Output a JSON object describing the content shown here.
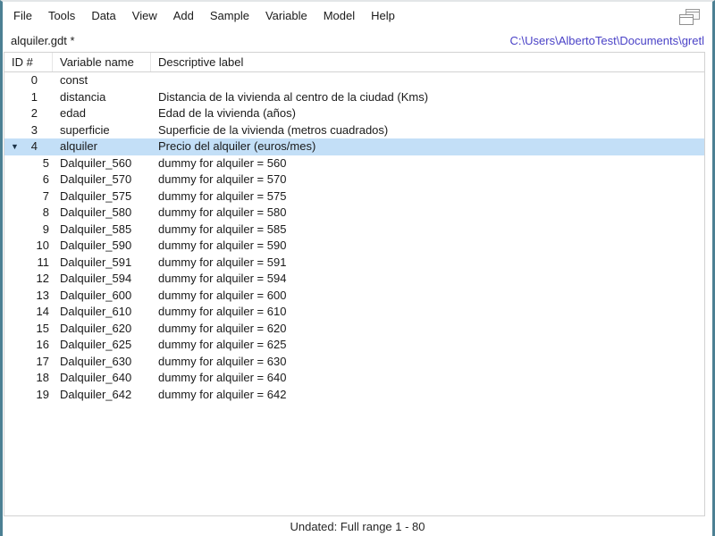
{
  "window": {
    "edge_color": "#4c8093"
  },
  "menu": {
    "items": [
      "File",
      "Tools",
      "Data",
      "View",
      "Add",
      "Sample",
      "Variable",
      "Model",
      "Help"
    ]
  },
  "titlebar": {
    "filename": "alquiler.gdt *",
    "workdir": "C:\\Users\\AlbertoTest\\Documents\\gretl",
    "workdir_style": "color:#4a42c7"
  },
  "table": {
    "columns": [
      "ID #",
      "Variable name",
      "Descriptive label"
    ],
    "expander_glyph": "▼",
    "selected_bg": "#c3dff7",
    "rows": [
      {
        "id": "0",
        "name": "const",
        "label": "",
        "child": false,
        "selected": false,
        "expander": false
      },
      {
        "id": "1",
        "name": "distancia",
        "label": "Distancia de la vivienda al centro de la ciudad (Kms)",
        "child": false,
        "selected": false,
        "expander": false
      },
      {
        "id": "2",
        "name": "edad",
        "label": "Edad de la vivienda (años)",
        "child": false,
        "selected": false,
        "expander": false
      },
      {
        "id": "3",
        "name": "superficie",
        "label": "Superficie de la vivienda (metros cuadrados)",
        "child": false,
        "selected": false,
        "expander": false
      },
      {
        "id": "4",
        "name": "alquiler",
        "label": "Precio del alquiler (euros/mes)",
        "child": false,
        "selected": true,
        "expander": true
      },
      {
        "id": "5",
        "name": "Dalquiler_560",
        "label": "dummy for alquiler = 560",
        "child": true,
        "selected": false,
        "expander": false
      },
      {
        "id": "6",
        "name": "Dalquiler_570",
        "label": "dummy for alquiler = 570",
        "child": true,
        "selected": false,
        "expander": false
      },
      {
        "id": "7",
        "name": "Dalquiler_575",
        "label": "dummy for alquiler = 575",
        "child": true,
        "selected": false,
        "expander": false
      },
      {
        "id": "8",
        "name": "Dalquiler_580",
        "label": "dummy for alquiler = 580",
        "child": true,
        "selected": false,
        "expander": false
      },
      {
        "id": "9",
        "name": "Dalquiler_585",
        "label": "dummy for alquiler = 585",
        "child": true,
        "selected": false,
        "expander": false
      },
      {
        "id": "10",
        "name": "Dalquiler_590",
        "label": "dummy for alquiler = 590",
        "child": true,
        "selected": false,
        "expander": false
      },
      {
        "id": "11",
        "name": "Dalquiler_591",
        "label": "dummy for alquiler = 591",
        "child": true,
        "selected": false,
        "expander": false
      },
      {
        "id": "12",
        "name": "Dalquiler_594",
        "label": "dummy for alquiler = 594",
        "child": true,
        "selected": false,
        "expander": false
      },
      {
        "id": "13",
        "name": "Dalquiler_600",
        "label": "dummy for alquiler = 600",
        "child": true,
        "selected": false,
        "expander": false
      },
      {
        "id": "14",
        "name": "Dalquiler_610",
        "label": "dummy for alquiler = 610",
        "child": true,
        "selected": false,
        "expander": false
      },
      {
        "id": "15",
        "name": "Dalquiler_620",
        "label": "dummy for alquiler = 620",
        "child": true,
        "selected": false,
        "expander": false
      },
      {
        "id": "16",
        "name": "Dalquiler_625",
        "label": "dummy for alquiler = 625",
        "child": true,
        "selected": false,
        "expander": false
      },
      {
        "id": "17",
        "name": "Dalquiler_630",
        "label": "dummy for alquiler = 630",
        "child": true,
        "selected": false,
        "expander": false
      },
      {
        "id": "18",
        "name": "Dalquiler_640",
        "label": "dummy for alquiler = 640",
        "child": true,
        "selected": false,
        "expander": false
      },
      {
        "id": "19",
        "name": "Dalquiler_642",
        "label": "dummy for alquiler = 642",
        "child": true,
        "selected": false,
        "expander": false
      }
    ]
  },
  "statusbar": {
    "text": "Undated: Full range 1 - 80"
  }
}
